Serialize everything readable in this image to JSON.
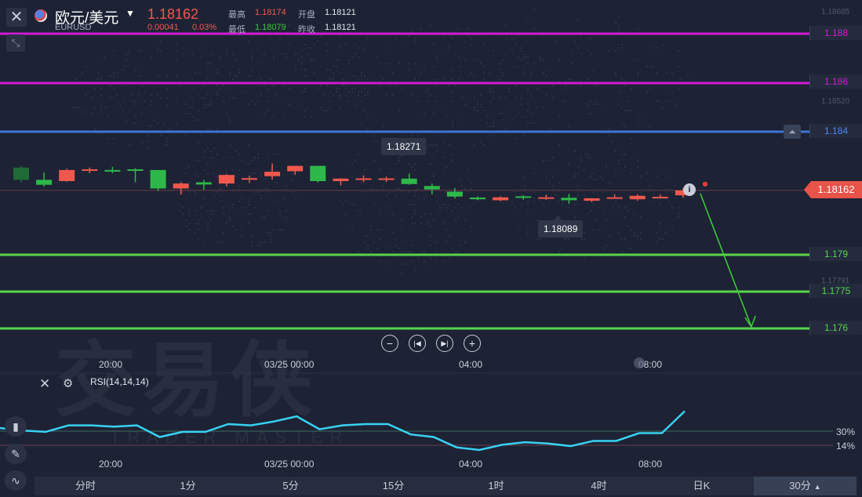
{
  "header": {
    "pair_name": "欧元/美元",
    "pair_code": "EURUSD",
    "price": "1.18162",
    "change": "0.00041",
    "change_pct": "0.03%",
    "high_label": "最高",
    "high_value": "1.18174",
    "low_label": "最低",
    "low_value": "1.18079",
    "open_label": "开盘",
    "open_value": "1.18121",
    "prev_close_label": "昨收",
    "prev_close_value": "1.18121"
  },
  "price_lines": [
    {
      "label": "1.188",
      "color": "#d21ad6"
    },
    {
      "label": "1.186",
      "color": "#d21ad6"
    },
    {
      "label": "1.184",
      "color": "#3f74d8"
    },
    {
      "label": "1.179",
      "color": "#58d44a"
    },
    {
      "label": "1.1775",
      "color": "#58d44a"
    },
    {
      "label": "1.176",
      "color": "#58d44a"
    }
  ],
  "axis_ghost_labels": [
    "1.18685",
    "1.18520",
    "1.17791"
  ],
  "current_price_tag": "1.18162",
  "tooltips": {
    "high": "1.18271",
    "low": "1.18089"
  },
  "time_axis": [
    "20:00",
    "03/25 00:00",
    "04:00",
    "08:00"
  ],
  "indicator": {
    "name": "RSI(14,14,14)",
    "level_30": "30%",
    "level_14": "14%"
  },
  "watermark": {
    "cn": "交易侠",
    "en": "TRADER MASTER"
  },
  "tabs": [
    "分时",
    "1分",
    "5分",
    "15分",
    "1时",
    "4时",
    "日K",
    "30分"
  ],
  "colors": {
    "up": "#f0584e",
    "down": "#2fb84a",
    "rsi": "#39d2f2",
    "background": "#1d2335"
  },
  "chart_data": {
    "type": "candlestick",
    "timeframe": "30分",
    "candles": [
      {
        "o": 1.18255,
        "h": 1.18262,
        "l": 1.18195,
        "c": 1.18205
      },
      {
        "o": 1.18205,
        "h": 1.18235,
        "l": 1.18178,
        "c": 1.18185
      },
      {
        "o": 1.182,
        "h": 1.1825,
        "l": 1.18198,
        "c": 1.18245
      },
      {
        "o": 1.18245,
        "h": 1.18255,
        "l": 1.18232,
        "c": 1.18248
      },
      {
        "o": 1.18245,
        "h": 1.18258,
        "l": 1.18232,
        "c": 1.1824
      },
      {
        "o": 1.18248,
        "h": 1.18252,
        "l": 1.18195,
        "c": 1.18245
      },
      {
        "o": 1.18245,
        "h": 1.18245,
        "l": 1.1816,
        "c": 1.1817
      },
      {
        "o": 1.1817,
        "h": 1.18195,
        "l": 1.18145,
        "c": 1.1819
      },
      {
        "o": 1.18195,
        "h": 1.18205,
        "l": 1.18165,
        "c": 1.18186
      },
      {
        "o": 1.1819,
        "h": 1.18228,
        "l": 1.18178,
        "c": 1.18225
      },
      {
        "o": 1.1821,
        "h": 1.18222,
        "l": 1.18192,
        "c": 1.18212
      },
      {
        "o": 1.1822,
        "h": 1.18272,
        "l": 1.18206,
        "c": 1.18238
      },
      {
        "o": 1.1824,
        "h": 1.1826,
        "l": 1.18225,
        "c": 1.18262
      },
      {
        "o": 1.18262,
        "h": 1.18262,
        "l": 1.18194,
        "c": 1.182
      },
      {
        "o": 1.182,
        "h": 1.18212,
        "l": 1.18182,
        "c": 1.1821
      },
      {
        "o": 1.18205,
        "h": 1.18223,
        "l": 1.18196,
        "c": 1.18211
      },
      {
        "o": 1.18205,
        "h": 1.18218,
        "l": 1.18196,
        "c": 1.18211
      },
      {
        "o": 1.1821,
        "h": 1.1823,
        "l": 1.18185,
        "c": 1.18188
      },
      {
        "o": 1.1818,
        "h": 1.1819,
        "l": 1.18146,
        "c": 1.18166
      },
      {
        "o": 1.18157,
        "h": 1.18172,
        "l": 1.18129,
        "c": 1.18137
      },
      {
        "o": 1.18133,
        "h": 1.18138,
        "l": 1.18122,
        "c": 1.18126
      },
      {
        "o": 1.18122,
        "h": 1.18138,
        "l": 1.18118,
        "c": 1.18134
      },
      {
        "o": 1.18138,
        "h": 1.18142,
        "l": 1.18124,
        "c": 1.18132
      },
      {
        "o": 1.18134,
        "h": 1.18145,
        "l": 1.18124,
        "c": 1.18134
      },
      {
        "o": 1.18132,
        "h": 1.18148,
        "l": 1.18108,
        "c": 1.18122
      },
      {
        "o": 1.1812,
        "h": 1.1813,
        "l": 1.18114,
        "c": 1.1813
      },
      {
        "o": 1.18134,
        "h": 1.18146,
        "l": 1.18129,
        "c": 1.18134
      },
      {
        "o": 1.18126,
        "h": 1.18146,
        "l": 1.1812,
        "c": 1.1814
      },
      {
        "o": 1.18134,
        "h": 1.18146,
        "l": 1.18129,
        "c": 1.18136
      },
      {
        "o": 1.18142,
        "h": 1.1817,
        "l": 1.18132,
        "c": 1.18162
      }
    ],
    "rsi": [
      0.57,
      0.55,
      0.54,
      0.59,
      0.59,
      0.58,
      0.59,
      0.5,
      0.54,
      0.54,
      0.6,
      0.59,
      0.62,
      0.66,
      0.56,
      0.59,
      0.6,
      0.6,
      0.52,
      0.5,
      0.42,
      0.4,
      0.44,
      0.46,
      0.45,
      0.43,
      0.47,
      0.47,
      0.53,
      0.53,
      0.7
    ],
    "projection": {
      "from": 1.18162,
      "to": 1.176
    }
  }
}
